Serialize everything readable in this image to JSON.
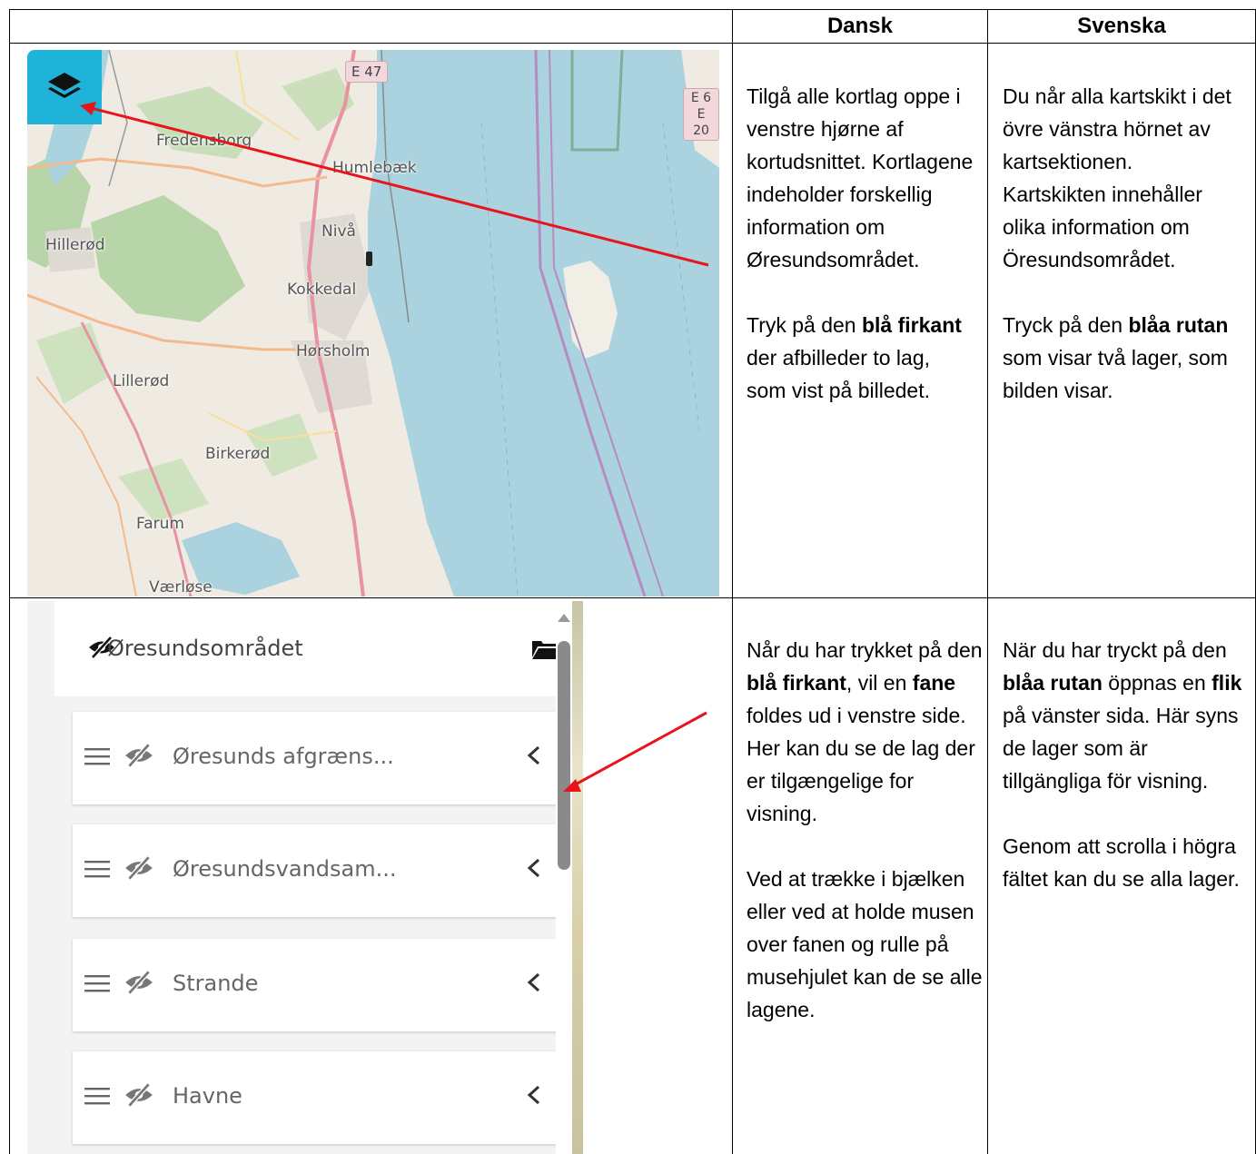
{
  "header": {
    "col_dansk": "Dansk",
    "col_svenska": "Svenska"
  },
  "map": {
    "labels": {
      "e47": "E 47",
      "e6": "E 6",
      "e20": "E 20",
      "fredensborg": "Fredensborg",
      "humlebaek": "Humlebæk",
      "hilleroed": "Hillerød",
      "nivaa": "Nivå",
      "kokkedal": "Kokkedal",
      "hoersholm": "Hørsholm",
      "lilleroed": "Lillerød",
      "birkeroed": "Birkerød",
      "farum": "Farum",
      "vaerloese": "Værløse"
    },
    "layers_button_icon": "layers-icon",
    "colors": {
      "water": "#aad3df",
      "button": "#1fb3d9",
      "forest": "#add19e",
      "road": "#e892a2"
    }
  },
  "row1": {
    "dansk_p1": "Tilgå alle kortlag oppe i venstre hjørne af kortudsnittet. Kortlagene indeholder forskellig information om Øresundsområdet.",
    "dansk_p2_a": "Tryk på den ",
    "dansk_p2_b": "blå firkant",
    "dansk_p2_c": " der afbilleder to lag, som vist på billedet.",
    "svenska_p1": "Du når alla kartskikt i det övre vänstra hörnet av kartsektionen. Kartskikten innehåller olika information om Öresundsområdet.",
    "svenska_p2_a": "Tryck på den ",
    "svenska_p2_b": "blåa rutan",
    "svenska_p2_c": " som visar två lager, som bilden visar."
  },
  "panel": {
    "group_title": "Øresundsområdet",
    "items": [
      {
        "label": "Øresunds afgræns..."
      },
      {
        "label": "Øresundsvandsam..."
      },
      {
        "label": "Strande"
      },
      {
        "label": "Havne"
      }
    ]
  },
  "row2": {
    "dansk_p1_a": "Når du har trykket på den ",
    "dansk_p1_b": "blå firkant",
    "dansk_p1_c": ", vil en ",
    "dansk_p1_d": "fane",
    "dansk_p1_e": " foldes ud i venstre side. Her kan du se de lag der er tilgængelige for visning.",
    "dansk_p2": "Ved at trække i bjælken eller ved at holde musen over fanen og rulle på musehjulet kan de se alle lagene.",
    "svenska_p1_a": "När du har tryckt på den ",
    "svenska_p1_b": "blåa rutan",
    "svenska_p1_c": " öppnas en ",
    "svenska_p1_d": "flik",
    "svenska_p1_e": " på vänster sida. Här syns de lager som är tillgängliga för visning.",
    "svenska_p2": "Genom att scrolla i högra fältet kan du se alla lager."
  }
}
